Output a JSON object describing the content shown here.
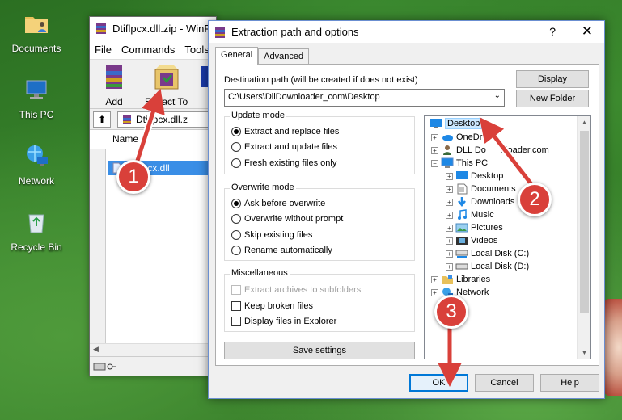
{
  "desktop": {
    "icons": [
      {
        "label": "Documents",
        "icon": "folder-user-icon"
      },
      {
        "label": "This PC",
        "icon": "computer-icon"
      },
      {
        "label": "Network",
        "icon": "network-icon"
      },
      {
        "label": "Recycle Bin",
        "icon": "recycle-bin-icon"
      }
    ]
  },
  "winrar": {
    "title": "Dtiflpcx.dll.zip - WinR",
    "menu": [
      "File",
      "Commands",
      "Tools"
    ],
    "toolbar": {
      "add": "Add",
      "extract_to": "Extract To",
      "third": "T"
    },
    "path": "Dtiflpcx.dll.z",
    "list_header": "Name",
    "selected_file": "dtiflpcx.dll"
  },
  "dialog": {
    "title": "Extraction path and options",
    "help": "?",
    "close": "✕",
    "tabs": {
      "general": "General",
      "advanced": "Advanced"
    },
    "destination_label": "Destination path (will be created if does not exist)",
    "destination_value": "C:\\Users\\DllDownloader_com\\Desktop",
    "display_button": "Display",
    "new_folder_button": "New Folder",
    "update_mode": {
      "title": "Update mode",
      "options": [
        "Extract and replace files",
        "Extract and update files",
        "Fresh existing files only"
      ],
      "selected": 0
    },
    "overwrite_mode": {
      "title": "Overwrite mode",
      "options": [
        "Ask before overwrite",
        "Overwrite without prompt",
        "Skip existing files",
        "Rename automatically"
      ],
      "selected": 0
    },
    "misc": {
      "title": "Miscellaneous",
      "options": [
        "Extract archives to subfolders",
        "Keep broken files",
        "Display files in Explorer"
      ]
    },
    "save_settings": "Save settings",
    "tree": {
      "desktop": "Desktop",
      "onedrive": "OneDr",
      "user": "DLL Do",
      "user_tail": "nloader.com",
      "this_pc": "This PC",
      "children": [
        "Desktop",
        "Documents",
        "Downloads",
        "Music",
        "Pictures",
        "Videos",
        "Local Disk (C:)",
        "Local Disk (D:)"
      ],
      "libraries": "Libraries",
      "network": "Network"
    },
    "ok": "OK",
    "cancel": "Cancel",
    "help_button": "Help"
  },
  "markers": [
    "1",
    "2",
    "3"
  ],
  "colors": {
    "marker": "#d9403a",
    "selection": "#3a8ee6",
    "ok_border": "#0078d7"
  }
}
